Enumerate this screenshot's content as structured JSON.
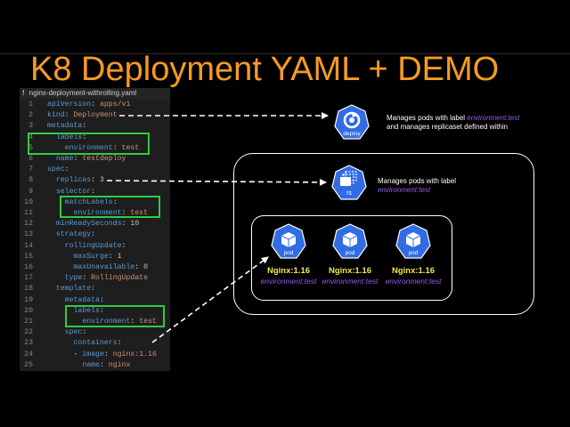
{
  "title": "K8 Deployment YAML + DEMO",
  "editor": {
    "tab_icon": "!",
    "filename": "nginx-deployment-withrolling.yaml",
    "lines": [
      {
        "num": "1",
        "indent": "",
        "key": "apiVersion",
        "sep": ": ",
        "val": "apps/v1",
        "vt": "v"
      },
      {
        "num": "2",
        "indent": "",
        "key": "kind",
        "sep": ": ",
        "val": "Deployment",
        "vt": "v"
      },
      {
        "num": "3",
        "indent": "",
        "key": "metadata",
        "sep": ":",
        "val": "",
        "vt": "v"
      },
      {
        "num": "4",
        "indent": "  ",
        "key": "labels",
        "sep": ":",
        "val": "",
        "vt": "v"
      },
      {
        "num": "5",
        "indent": "    ",
        "key": "environment",
        "sep": ": ",
        "val": "test",
        "vt": "v"
      },
      {
        "num": "6",
        "indent": "  ",
        "key": "name",
        "sep": ": ",
        "val": "testdeploy",
        "vt": "v"
      },
      {
        "num": "7",
        "indent": "",
        "key": "spec",
        "sep": ":",
        "val": "",
        "vt": "v"
      },
      {
        "num": "8",
        "indent": "  ",
        "key": "replicas",
        "sep": ": ",
        "val": "3",
        "vt": "n"
      },
      {
        "num": "9",
        "indent": "  ",
        "key": "selector",
        "sep": ":",
        "val": "",
        "vt": "v"
      },
      {
        "num": "10",
        "indent": "    ",
        "key": "matchLabels",
        "sep": ":",
        "val": "",
        "vt": "v"
      },
      {
        "num": "11",
        "indent": "      ",
        "key": "environment",
        "sep": ": ",
        "val": "test",
        "vt": "v"
      },
      {
        "num": "12",
        "indent": "  ",
        "key": "minReadySeconds",
        "sep": ": ",
        "val": "10",
        "vt": "n"
      },
      {
        "num": "13",
        "indent": "  ",
        "key": "strategy",
        "sep": ":",
        "val": "",
        "vt": "v"
      },
      {
        "num": "14",
        "indent": "    ",
        "key": "rollingUpdate",
        "sep": ":",
        "val": "",
        "vt": "v"
      },
      {
        "num": "15",
        "indent": "      ",
        "key": "maxSurge",
        "sep": ": ",
        "val": "1",
        "vt": "n"
      },
      {
        "num": "16",
        "indent": "      ",
        "key": "maxUnavailable",
        "sep": ": ",
        "val": "0",
        "vt": "n"
      },
      {
        "num": "17",
        "indent": "    ",
        "key": "type",
        "sep": ": ",
        "val": "RollingUpdate",
        "vt": "v"
      },
      {
        "num": "18",
        "indent": "  ",
        "key": "template",
        "sep": ":",
        "val": "",
        "vt": "v"
      },
      {
        "num": "19",
        "indent": "    ",
        "key": "metadata",
        "sep": ":",
        "val": "",
        "vt": "v"
      },
      {
        "num": "20",
        "indent": "      ",
        "key": "labels",
        "sep": ":",
        "val": "",
        "vt": "v"
      },
      {
        "num": "21",
        "indent": "        ",
        "key": "environment",
        "sep": ": ",
        "val": "test",
        "vt": "v"
      },
      {
        "num": "22",
        "indent": "    ",
        "key": "spec",
        "sep": ":",
        "val": "",
        "vt": "v"
      },
      {
        "num": "23",
        "indent": "      ",
        "key": "containers",
        "sep": ":",
        "val": "",
        "vt": "v"
      },
      {
        "num": "24",
        "indent": "      - ",
        "key": "image",
        "sep": ": ",
        "val": "nginx:1.16",
        "vt": "v"
      },
      {
        "num": "25",
        "indent": "        ",
        "key": "name",
        "sep": ": ",
        "val": "nginx",
        "vt": "v"
      }
    ]
  },
  "deploy": {
    "icon_label": "deploy",
    "desc_line1": "Manages pods with label ",
    "desc_label": "environment:test",
    "desc_line2": "and manages replicaset defined within"
  },
  "rs": {
    "icon_label": "rs",
    "desc_line1": "Manages pods with label",
    "desc_label": "environment:test"
  },
  "pods": [
    {
      "icon_label": "pod",
      "image": "Nginx:1.16",
      "label": "environment:test"
    },
    {
      "icon_label": "pod",
      "image": "Nginx:1.16",
      "label": "environment:test"
    },
    {
      "icon_label": "pod",
      "image": "Nginx:1.16",
      "label": "environment:test"
    }
  ],
  "colors": {
    "title": "#f59a23",
    "highlight": "#2ecc40",
    "k8s_blue": "#326ce5",
    "label_purple": "#9b59f5",
    "pod_text": "#f1e64b"
  }
}
